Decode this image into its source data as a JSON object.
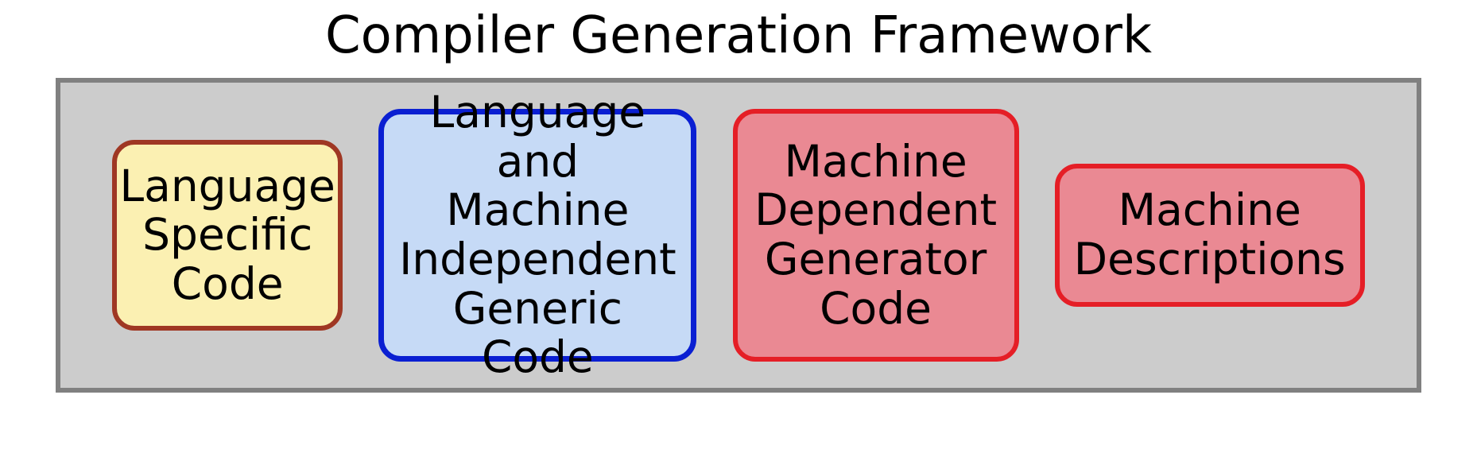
{
  "title": "Compiler Generation Framework",
  "boxes": [
    {
      "label": "Language\nSpecific\nCode"
    },
    {
      "label": "Language and\nMachine\nIndependent\nGeneric Code"
    },
    {
      "label": "Machine\nDependent\nGenerator\nCode"
    },
    {
      "label": "Machine\nDescriptions"
    }
  ]
}
